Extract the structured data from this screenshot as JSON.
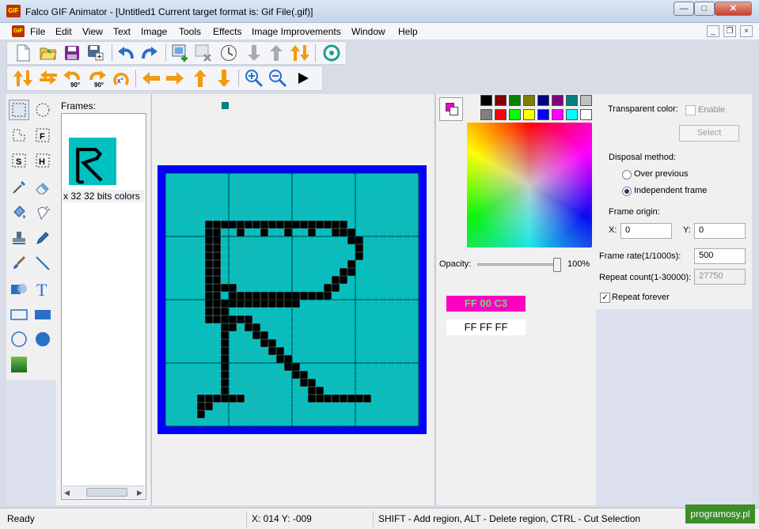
{
  "window": {
    "title": "Falco GIF Animator - [Untitled1  Current target format is: Gif File(.gif)]",
    "app_icon_text": "GIF"
  },
  "menu": [
    "File",
    "Edit",
    "View",
    "Text",
    "Image",
    "Tools",
    "Effects",
    "Image Improvements",
    "Window",
    "Help"
  ],
  "toolbar1": {
    "icons": [
      "new-file-icon",
      "open-folder-icon",
      "save-icon",
      "save-as-icon",
      "undo-icon",
      "redo-icon",
      "add-frame-icon",
      "delete-frame-icon",
      "frame-timing-icon",
      "move-frame-down-icon",
      "move-frame-up-icon",
      "swap-frames-icon",
      "preview-icon"
    ]
  },
  "toolbar2": {
    "icons": [
      "flip-vertical-icon",
      "flip-horizontal-icon",
      "rotate-90-ccw-icon",
      "rotate-90-cw-icon",
      "rotate-custom-icon",
      "move-left-icon",
      "move-right-icon",
      "move-up-icon",
      "move-down-icon",
      "zoom-in-icon",
      "zoom-out-icon",
      "play-icon"
    ],
    "rot_label": "90°",
    "rot_label2": "90°",
    "rot_custom_label": "x°"
  },
  "tools": [
    "rect-select",
    "ellipse-select",
    "lasso-select",
    "magic-f",
    "magic-s",
    "magic-h",
    "pipette",
    "eraser",
    "fill",
    "spray",
    "stamp",
    "pen",
    "brush",
    "line",
    "gradient",
    "text",
    "rectangle",
    "filled-rectangle",
    "ellipse",
    "filled-ellipse",
    "color-gradient"
  ],
  "frames": {
    "label": "Frames:",
    "items": [
      {
        "caption": "x 32 32 bits colors"
      }
    ]
  },
  "palette": {
    "row1": [
      "#000000",
      "#800000",
      "#008000",
      "#808000",
      "#000080",
      "#800080",
      "#008080",
      "#c0c0c0"
    ],
    "row2": [
      "#808080",
      "#ff0000",
      "#00ff00",
      "#ffff00",
      "#0000ff",
      "#ff00ff",
      "#00ffff",
      "#ffffff"
    ],
    "primary": "#ff00c3",
    "secondary": "#ffffff"
  },
  "opacity": {
    "label": "Opacity:",
    "value": "100%",
    "level": 1.0
  },
  "hex": {
    "primary": "FF 00 C3",
    "secondary": "FF FF FF",
    "primary_color": "#ff00c3"
  },
  "properties": {
    "transparent_label": "Transparent color:",
    "enable_label": "Enable",
    "select_label": "Select",
    "disposal_label": "Disposal method:",
    "over_previous": "Over previous",
    "independent": "Independent frame",
    "origin_label": "Frame origin:",
    "x_label": "X:",
    "x_value": "0",
    "y_label": "Y:",
    "y_value": "0",
    "rate_label": "Frame rate(1/1000s):",
    "rate_value": "500",
    "repeat_label": "Repeat count(1-30000):",
    "repeat_value": "27750",
    "repeat_forever": "Repeat forever"
  },
  "status": {
    "ready": "Ready",
    "coords": "X: 014 Y: -009",
    "hint": "SHIFT - Add region, ALT - Delete region, CTRL - Cut Selection"
  },
  "watermark": "programosy.pl",
  "canvas": {
    "border_color": "#0000ff",
    "bg_color": "#00c0c0",
    "ink_color": "#000000"
  }
}
